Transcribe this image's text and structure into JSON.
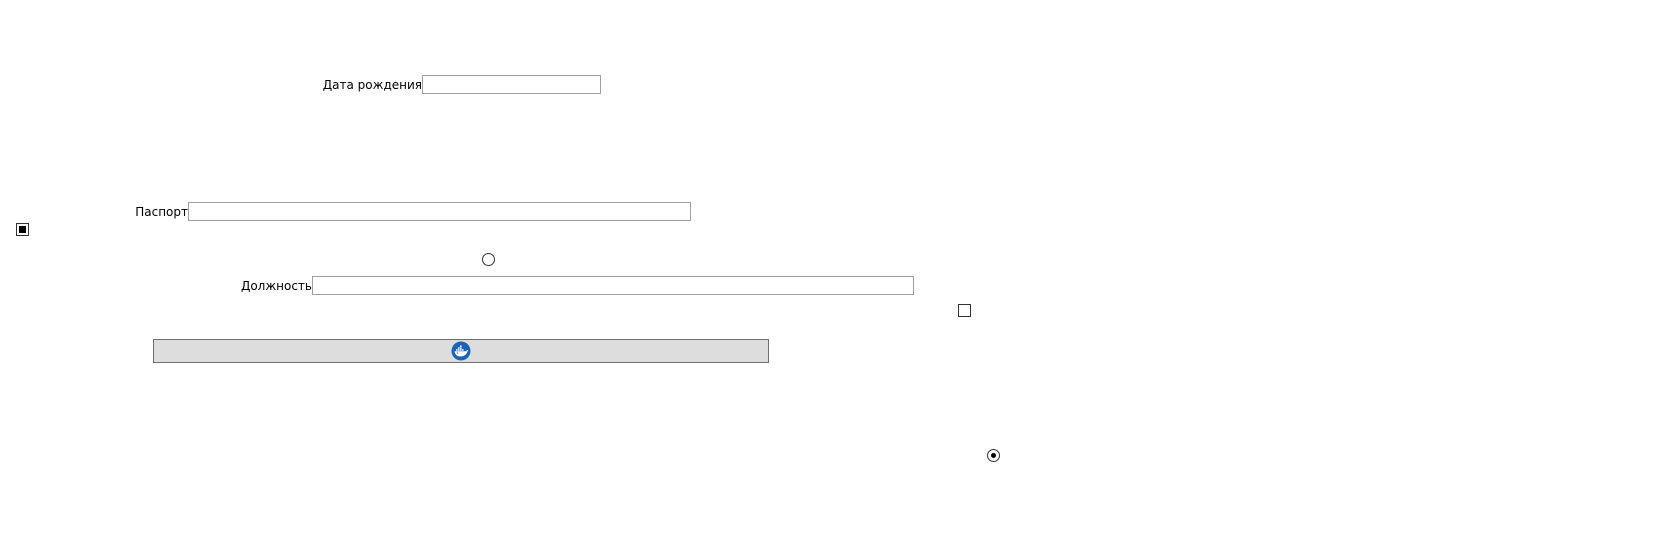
{
  "form": {
    "birth_date": {
      "label": "Дата рождения",
      "value": ""
    },
    "passport": {
      "label": "Паспорт",
      "value": ""
    },
    "position": {
      "label": "Должность",
      "value": ""
    },
    "checkbox_left": {
      "state": "indeterminate"
    },
    "checkbox_right": {
      "state": "unchecked"
    },
    "radio_top": {
      "checked": false
    },
    "radio_bottom": {
      "checked": true
    },
    "image_button": {
      "icon": "docker-whale-icon",
      "icon_color": "#1d63b4"
    }
  }
}
